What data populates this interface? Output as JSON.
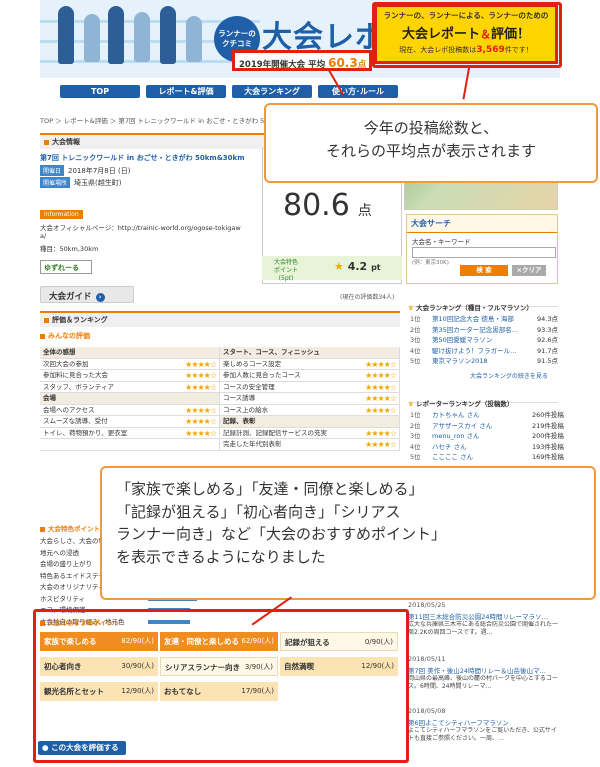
{
  "header": {
    "logo_circle": "ランナーの\nクチコミ",
    "logo_main": "大会レポ",
    "avg_label": "2019年開催大会 平均",
    "avg_value": "60.3",
    "avg_unit": "点",
    "tag_line1": "ランナーの、ランナーによる、ランナーのための",
    "tag_line2_a": "大会レポート",
    "tag_line2_amp": "＆",
    "tag_line2_b": "評価！",
    "tag_line3_pre": "現在、大会レポ投稿数は",
    "tag_line3_count": "3,569",
    "tag_line3_post": "件です！"
  },
  "nav": [
    "TOP",
    "レポート&評価",
    "大会ランキング",
    "使い方･ルール"
  ],
  "breadcrumb": "TOP ＞ レポート&評価 ＞ 第7回 トレニックワールド in おごせ・ときがわ 50",
  "race_info": {
    "section_title": "大会情報",
    "name": "第7回 トレニックワールド in おごせ・ときがわ 50km&30km",
    "date_label": "開催日",
    "date_value": "2018年7月8日 (日)",
    "place_label": "開催場所",
    "place_value": "埼玉県(越生町)",
    "info_badge": "information",
    "official_label": "大会オフィシャルページ：http://trainic-world.org/ogose-tokigaw",
    "official_label2": "a/",
    "events": "種目：50km,30km",
    "app_badge": "ゆずれーる",
    "guide_button": "大会ガイド"
  },
  "score_card": {
    "score": "80.6",
    "unit": "点",
    "feature_label": "大会特色\nポイント(5pt)",
    "feature_star": "★",
    "feature_value": "4.2",
    "feature_unit": "pt",
    "count_note": "(現在の評価数34人)"
  },
  "rating": {
    "section_title": "評価＆ランキング",
    "subtitle": "みんなの評価",
    "rows": [
      {
        "l": "全体の感想",
        "ls": "",
        "r": "スタート、コース、フィニッシュ",
        "rs": "",
        "head": true
      },
      {
        "l": "次回大会の参加",
        "ls": "★★★★☆",
        "r": "楽しめるコース設定",
        "rs": "★★★★☆"
      },
      {
        "l": "参加料に見合った大会",
        "ls": "★★★★☆",
        "r": "参加人数に見合ったコース",
        "rs": "★★★★☆"
      },
      {
        "l": "スタッフ、ボランティア",
        "ls": "★★★★☆",
        "r": "コースの安全管理",
        "rs": "★★★★☆"
      },
      {
        "l": "会場",
        "ls": "",
        "r": "コース誘導",
        "rs": "★★★★☆",
        "lhead": true
      },
      {
        "l": "会場へのアクセス",
        "ls": "★★★★☆",
        "r": "コース上の給水",
        "rs": "★★★★☆"
      },
      {
        "l": "スムーズな誘導、受付",
        "ls": "★★★★☆",
        "r": "記録、表彰",
        "rs": "",
        "rhead": true
      },
      {
        "l": "トイレ、荷物預かり、更衣室",
        "ls": "★★★★☆",
        "r": "記録計測、記録配信サービスの充実",
        "rs": "★★★★☆"
      },
      {
        "l": "",
        "ls": "",
        "r": "完走した年代別表彰",
        "rs": "★★★★☆"
      }
    ]
  },
  "features": {
    "section_title": "大会特色ポイント",
    "rows": [
      {
        "label": "大会らしさ、大会の特徴",
        "level": 0.8
      },
      {
        "label": "地元への浸透",
        "level": 0.6
      },
      {
        "label": "会場の盛り上がり",
        "level": 0.6
      },
      {
        "label": "特色あるエイドステーション",
        "level": 0.7
      },
      {
        "label": "大会のオリジナリティ",
        "level": 0.6
      },
      {
        "label": "ホスピタリティ",
        "level": 0.7
      },
      {
        "label": "エコ、環境保護",
        "level": 0.6
      },
      {
        "label": "大会独自の取り組み、地元色",
        "level": 0.6
      }
    ]
  },
  "recommend": {
    "section_title": "大会のおすすめポイント",
    "cells": [
      {
        "label": "家族で楽しめる",
        "pts": "82/90(人)",
        "tone": "hi"
      },
      {
        "label": "友達・同僚と楽しめる",
        "pts": "62/90(人)",
        "tone": "hi"
      },
      {
        "label": "記録が狙える",
        "pts": "0/90(人)",
        "tone": "lo"
      },
      {
        "label": "初心者向き",
        "pts": "30/90(人)",
        "tone": "mid"
      },
      {
        "label": "シリアスランナー向き",
        "pts": "3/90(人)",
        "tone": "lo"
      },
      {
        "label": "自然満喫",
        "pts": "12/90(人)",
        "tone": "mid"
      },
      {
        "label": "観光名所とセット",
        "pts": "12/90(人)",
        "tone": "mid"
      },
      {
        "label": "おもてなし",
        "pts": "17/90(人)",
        "tone": "mid"
      }
    ],
    "eval_button": "この大会を評価する"
  },
  "sidebar": {
    "search_title": "大会サーチ",
    "search_label": "大会名・キーワード",
    "search_hint": "(例：東京30K)",
    "search_button": "検 索",
    "clear_button": "×クリア",
    "ranking_title": "大会ランキング（種目・フルマラソン）",
    "ranking": [
      {
        "n": "1位",
        "t": "第10回記念大会 徳島・海部",
        "v": "94.3点"
      },
      {
        "n": "2位",
        "t": "第35回カーター記念黒部名…",
        "v": "93.3点"
      },
      {
        "n": "3位",
        "t": "第50回愛媛マラソン",
        "v": "92.6点"
      },
      {
        "n": "4位",
        "t": "駆け抜けよう！フラガール…",
        "v": "91.7点"
      },
      {
        "n": "5位",
        "t": "東京マラソン2018",
        "v": "91.5点"
      }
    ],
    "ranking_more": "大会ランキングの続きを見る",
    "reporter_title": "レポーターランキング（投稿数）",
    "reporters": [
      {
        "n": "1位",
        "t": "カトちゃん さん",
        "v": "260件投稿"
      },
      {
        "n": "2位",
        "t": "アサザースカイ さん",
        "v": "219件投稿"
      },
      {
        "n": "3位",
        "t": "menu_ron さん",
        "v": "200件投稿"
      },
      {
        "n": "4位",
        "t": "ハセチ さん",
        "v": "193件投稿"
      },
      {
        "n": "5位",
        "t": "ここここ さん",
        "v": "169件投稿"
      }
    ],
    "news": [
      {
        "date": "2018/05/25",
        "title": "第11回三木総合防災公園24時間リレーマラソ…",
        "body": "広大な兵庫県三木市にある総合防災公園で開催された一周2.2Kの周回コースです。週…"
      },
      {
        "date": "2018/05/11",
        "title": "第7回 美作・後山24時間リレー＆山岳後山マ…",
        "body": "岡山県の最高峰、後山の麓の村パークを中心とするコース。6時間、24時間リレーマ…"
      },
      {
        "date": "2018/05/08",
        "title": "第6回よこてシティハーフマラソン",
        "body": "よこてシティハーフマラソンをご覧いただき、公式サイトも直接ご参照ください。一周、…"
      }
    ]
  },
  "callouts": {
    "top_line1": "今年の投稿総数と、",
    "top_line2": "それらの平均点が表示されます",
    "mid_line1": "「家族で楽しめる」「友達・同僚と楽しめる」",
    "mid_line2": "「記録が狙える」「初心者向き」「シリアス",
    "mid_line3": "ランナー向き」など「大会のおすすめポイント」",
    "mid_line4": "を表示できるようになりました"
  },
  "colors": {
    "brand_blue": "#1e5fa8",
    "accent_orange": "#ef7d00",
    "highlight_red": "#e02010",
    "tag_yellow": "#ffd400"
  }
}
